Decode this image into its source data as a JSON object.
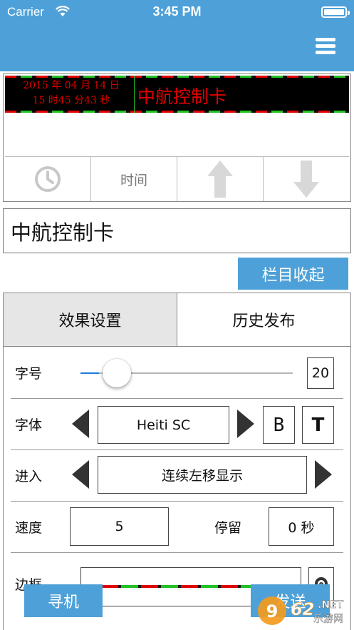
{
  "status_bar": {
    "carrier": "Carrier",
    "time": "3:45 PM"
  },
  "preview": {
    "date_line1": "2015 年 04 月 14 日",
    "date_line2": "15 时45 分43 秒",
    "display_text": "中航控制卡",
    "led_text_color": "#e00000",
    "led_border_colors": [
      "#e00000",
      "#24c024"
    ],
    "controls": [
      {
        "icon": "clock-icon",
        "label": ""
      },
      {
        "icon": "",
        "label": "时间"
      },
      {
        "icon": "arrow-up-icon",
        "label": ""
      },
      {
        "icon": "arrow-down-icon",
        "label": ""
      }
    ]
  },
  "text_input": {
    "value": "中航控制卡"
  },
  "collapse_button": "栏目收起",
  "tabs": [
    {
      "label": "效果设置",
      "active": true
    },
    {
      "label": "历史发布",
      "active": false
    }
  ],
  "settings": {
    "font_size": {
      "label": "字号",
      "value": "20",
      "slider_fraction": 0.12
    },
    "font": {
      "label": "字体",
      "value": "Heiti SC",
      "bold_label": "B",
      "text_label": "T"
    },
    "entry": {
      "label": "进入",
      "value": "连续左移显示"
    },
    "speed": {
      "label": "速度",
      "value": "5",
      "stay_label": "停留",
      "stay_value": "0 秒"
    },
    "border": {
      "label": "边框"
    }
  },
  "bottom_buttons": {
    "search": "寻机",
    "send": "发送"
  },
  "watermark": "962乐游网",
  "colors": {
    "accent": "#4ea1d8",
    "led_background": "#000000"
  }
}
